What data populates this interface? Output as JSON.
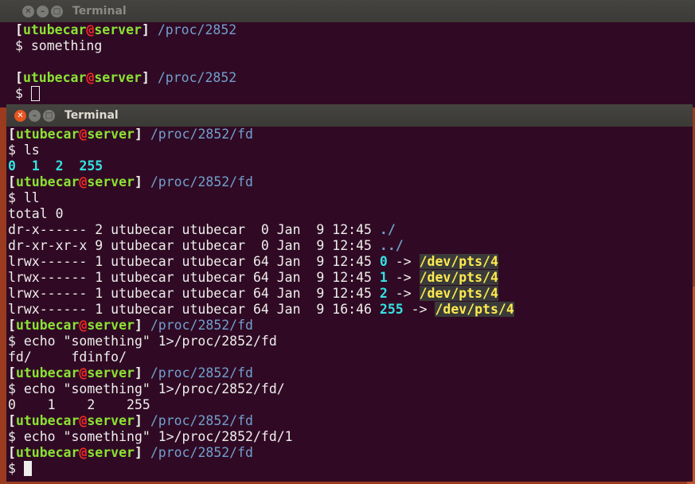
{
  "colors": {
    "terminal_bg": "#300a24",
    "user": "#8ae234",
    "at": "#ef2929",
    "path": "#729fcf",
    "number": "#34e2e2",
    "link_target": "#fce94f",
    "close_button": "#e95420"
  },
  "back_window": {
    "title": "Terminal",
    "prompt1": {
      "open": "[",
      "user": "utubecar",
      "at": "@",
      "host": "server",
      "close": "]",
      "path": "/proc/2852"
    },
    "cmd1": "$ something",
    "prompt2": {
      "open": "[",
      "user": "utubecar",
      "at": "@",
      "host": "server",
      "close": "]",
      "path": "/proc/2852"
    },
    "cmd2": "$ "
  },
  "front_window": {
    "title": "Terminal",
    "p1": {
      "user": "utubecar",
      "at": "@",
      "host": "server",
      "path": "/proc/2852/fd"
    },
    "c1": "$ ls",
    "ls_out": [
      "0",
      "1",
      "2",
      "255"
    ],
    "p2": {
      "user": "utubecar",
      "at": "@",
      "host": "server",
      "path": "/proc/2852/fd"
    },
    "c2": "$ ll",
    "total": "total 0",
    "ll_rows": [
      {
        "perm": "dr-x------ 2 utubecar utubecar  0 Jan  9 12:45 ",
        "name": "./"
      },
      {
        "perm": "dr-xr-xr-x 9 utubecar utubecar  0 Jan  9 12:45 ",
        "name": "../"
      },
      {
        "perm": "lrwx------ 1 utubecar utubecar 64 Jan  9 12:45 ",
        "name": "0",
        "arrow": " -> ",
        "target": "/dev/pts/4"
      },
      {
        "perm": "lrwx------ 1 utubecar utubecar 64 Jan  9 12:45 ",
        "name": "1",
        "arrow": " -> ",
        "target": "/dev/pts/4"
      },
      {
        "perm": "lrwx------ 1 utubecar utubecar 64 Jan  9 12:45 ",
        "name": "2",
        "arrow": " -> ",
        "target": "/dev/pts/4"
      },
      {
        "perm": "lrwx------ 1 utubecar utubecar 64 Jan  9 16:46 ",
        "name": "255",
        "arrow": " -> ",
        "target": "/dev/pts/4"
      }
    ],
    "p3": {
      "user": "utubecar",
      "at": "@",
      "host": "server",
      "path": "/proc/2852/fd"
    },
    "c3": "$ echo \"something\" 1>/proc/2852/fd",
    "o3": "fd/     fdinfo/",
    "p4": {
      "user": "utubecar",
      "at": "@",
      "host": "server",
      "path": "/proc/2852/fd"
    },
    "c4": "$ echo \"something\" 1>/proc/2852/fd/",
    "o4": "0    1    2    255",
    "p5": {
      "user": "utubecar",
      "at": "@",
      "host": "server",
      "path": "/proc/2852/fd"
    },
    "c5": "$ echo \"something\" 1>/proc/2852/fd/1",
    "p6": {
      "user": "utubecar",
      "at": "@",
      "host": "server",
      "path": "/proc/2852/fd"
    },
    "c6": "$ "
  }
}
